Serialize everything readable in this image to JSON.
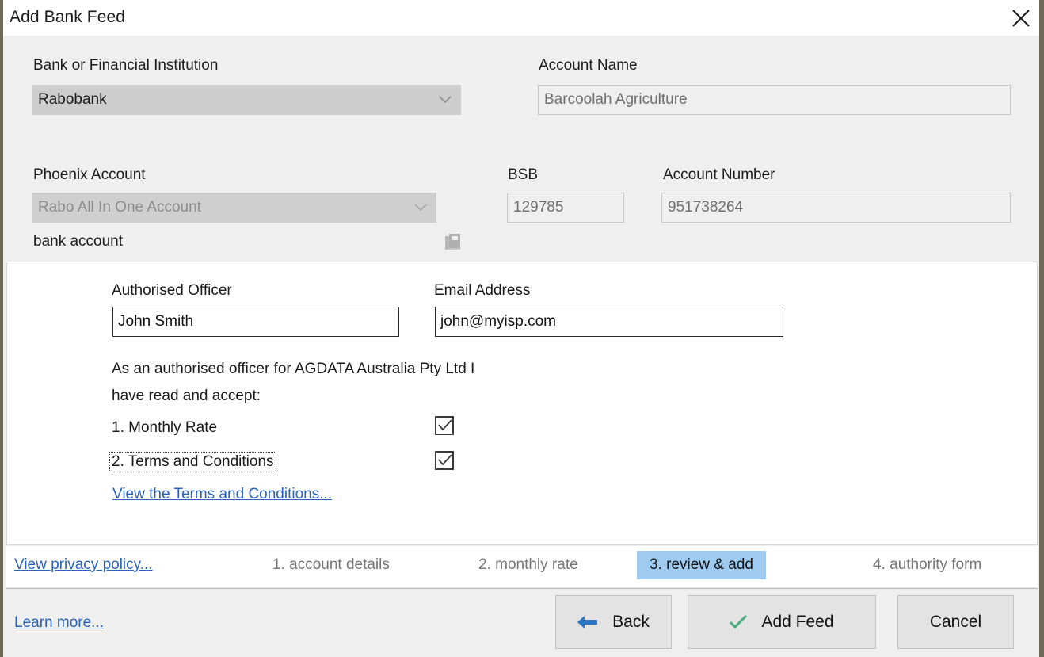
{
  "window": {
    "title": "Add Bank Feed",
    "close_icon": "close-icon"
  },
  "top_form": {
    "bank_label": "Bank or Financial Institution",
    "bank_value": "Rabobank",
    "account_name_label": "Account Name",
    "account_name_value": "Barcoolah Agriculture",
    "phoenix_label": "Phoenix Account",
    "phoenix_value": "Rabo All In One Account",
    "phoenix_hint": "bank account",
    "phoenix_icon": "book-ledger-icon",
    "bsb_label": "BSB",
    "bsb_value": "129785",
    "account_number_label": "Account Number",
    "account_number_value": "951738264"
  },
  "review_panel": {
    "officer_label": "Authorised Officer",
    "officer_value": "John Smith",
    "email_label": "Email Address",
    "email_value": "john@myisp.com",
    "consent_line1": "As an authorised officer for AGDATA Australia Pty Ltd I",
    "consent_line2": "have read and accept:",
    "accept_items": [
      {
        "label": "1. Monthly Rate",
        "checked": true,
        "focused": false
      },
      {
        "label": "2. Terms and Conditions",
        "checked": true,
        "focused": true
      }
    ],
    "terms_link": "View the Terms and Conditions..."
  },
  "steps_bar": {
    "privacy_link": "View privacy policy...",
    "steps": [
      {
        "label": "1. account details",
        "active": false
      },
      {
        "label": "2. monthly rate",
        "active": false
      },
      {
        "label": "3. review & add",
        "active": true
      },
      {
        "label": "4. authority form",
        "active": false
      }
    ]
  },
  "bottom_bar": {
    "learn_link": "Learn more...",
    "back_label": "Back",
    "back_icon": "arrow-left-icon",
    "add_feed_label": "Add Feed",
    "add_feed_icon": "check-icon",
    "cancel_label": "Cancel"
  },
  "colors": {
    "accent_blue": "#2a63b8",
    "active_step_bg": "#9ecbef",
    "check_green": "#4aab7d",
    "arrow_blue": "#2a74c4"
  }
}
